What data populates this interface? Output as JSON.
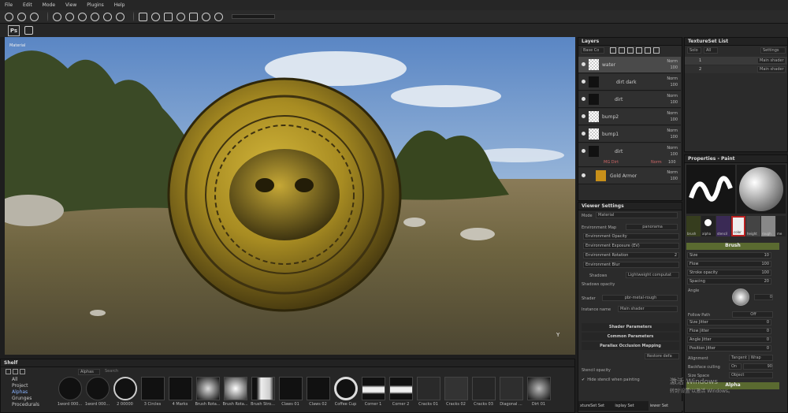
{
  "menu": [
    "File",
    "Edit",
    "Mode",
    "View",
    "Plugins",
    "Help"
  ],
  "viewport": {
    "label": "Material"
  },
  "layers": {
    "title": "Layers",
    "blend_select": "Base Co",
    "items": [
      {
        "name": "water",
        "mode": "Norm",
        "opacity": "100"
      },
      {
        "name": "dirt dark",
        "mode": "Norm",
        "opacity": "100"
      },
      {
        "name": "dirt",
        "mode": "Norm",
        "opacity": "100"
      },
      {
        "name": "bump2",
        "mode": "Norm",
        "opacity": "100"
      },
      {
        "name": "bump1",
        "mode": "Norm",
        "opacity": "100"
      },
      {
        "name": "dirt",
        "mode": "Norm",
        "opacity": "100"
      },
      {
        "name": "MG Dirt",
        "mode": "Norm",
        "opacity": "100"
      },
      {
        "name": "Gold Armor",
        "mode": "Norm",
        "opacity": "100"
      }
    ]
  },
  "textureset": {
    "title": "TextureSet List",
    "solo": "Solo",
    "all": "All",
    "settings": "Settings",
    "rows": [
      {
        "id": "1",
        "shader": "Main shader"
      },
      {
        "id": "2",
        "shader": "Main shader"
      }
    ]
  },
  "viewer": {
    "title": "Viewer Settings",
    "mode_label": "Mode",
    "mode_value": "Material",
    "envmap_label": "Environment Map",
    "envmap_value": "panorama",
    "rows": [
      "Environment Opacity",
      "Environment Exposure (EV)",
      "Environment Rotation",
      "Environment Blur"
    ],
    "rotation_value": "2",
    "shadows": "Shadows",
    "shadows_btn": "Lightweight computat",
    "shadows_opacity": "Shadows opacity",
    "shader_label": "Shader",
    "shader_value": "pbr-metal-rough",
    "instance_label": "Instance name",
    "instance_value": "Main shader",
    "sections": [
      "Shader Parameters",
      "Common Parameters",
      "Parallax Occlusion Mapping"
    ],
    "restore": "Restore defa",
    "stencil_opacity": "Stencil opacity",
    "hide_stencil": "Hide stencil when painting",
    "tabs": [
      "xtureSet Set",
      "isplay Set",
      "iewer Set"
    ]
  },
  "properties": {
    "title": "Properties - Paint",
    "slots": [
      "brush",
      "alpha",
      "stencil",
      "color",
      "height",
      "rough",
      "me"
    ],
    "brush_header": "Brush",
    "params": [
      {
        "label": "Size",
        "value": "10"
      },
      {
        "label": "Flow",
        "value": "100"
      },
      {
        "label": "Stroke opacity",
        "value": "100"
      },
      {
        "label": "Spacing",
        "value": "20"
      }
    ],
    "angle": "Angle",
    "angle_value": "0",
    "follow": "Follow Path",
    "follow_value": "Off",
    "jitters": [
      {
        "label": "Size Jitter",
        "value": "0"
      },
      {
        "label": "Flow Jitter",
        "value": "0"
      },
      {
        "label": "Angle Jitter",
        "value": "0"
      },
      {
        "label": "Position Jitter",
        "value": "0"
      }
    ],
    "alignment": "Alignment",
    "alignment_value": "Tangent | Wrap",
    "backface": "Backface culling",
    "backface_on": "On",
    "backface_value": "90",
    "sizespace": "Size Space",
    "sizespace_value": "Object",
    "alpha_header": "Alpha"
  },
  "shelf": {
    "title": "Shelf",
    "tab": "Alphas",
    "search_placeholder": "Search",
    "categories": [
      "All",
      "Project",
      "Alphas",
      "Grunges",
      "Procedurals"
    ],
    "items": [
      "1word 000...",
      "1word 000...",
      "2 00000",
      "3 Circles",
      "4 Marks",
      "Brush Rota...",
      "Brush Rota...",
      "Brush Stro...",
      "Claws 01",
      "Claws 02",
      "Coffee Cup",
      "Corner 1",
      "Corner 2",
      "Cracks 01",
      "Cracks 02",
      "Cracks 03",
      "Diagonal ...",
      "Dirt 01"
    ]
  },
  "watermark": {
    "line1": "激活 Windows",
    "line2": "转到'设置'以激活 Windows。"
  },
  "colors": {
    "accent": "#5a6a30",
    "gold": "#b89a2a",
    "sky": "#7ea4d0"
  }
}
